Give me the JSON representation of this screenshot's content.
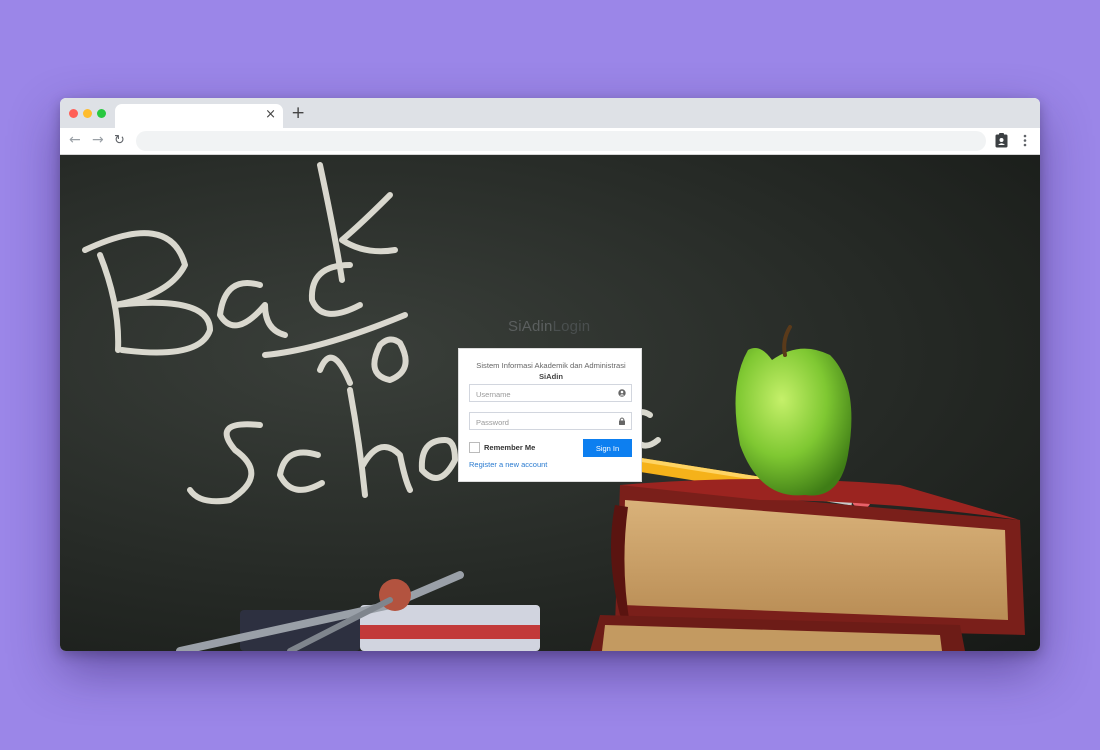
{
  "browser": {
    "tab_title": "",
    "tab_close": "×",
    "new_tab": "+",
    "address": "",
    "back_glyph": "←",
    "forward_glyph": "→",
    "reload_glyph": "↻"
  },
  "background": {
    "chalk_text": [
      "Back",
      "To",
      "School"
    ],
    "accent_colors": {
      "chalkboard": "#262a26",
      "apple": "#7fc832",
      "pencil": "#f5b21a",
      "book": "#9b2420"
    }
  },
  "login": {
    "brand_bold": "SiAdin",
    "brand_light": "Login",
    "message": "Sistem Informasi Akademik dan Administrasi",
    "subtitle": "SiAdin",
    "username_placeholder": "Username",
    "password_placeholder": "Password",
    "remember_label": "Remember Me",
    "signin_label": "Sign In",
    "register_label": "Register a new account",
    "primary_color": "#0d7ff0"
  },
  "icons": {
    "user_field": "user-circle-icon",
    "password_field": "lock-icon",
    "extension": "clipboard-user-icon",
    "menu": "kebab-menu-icon"
  }
}
